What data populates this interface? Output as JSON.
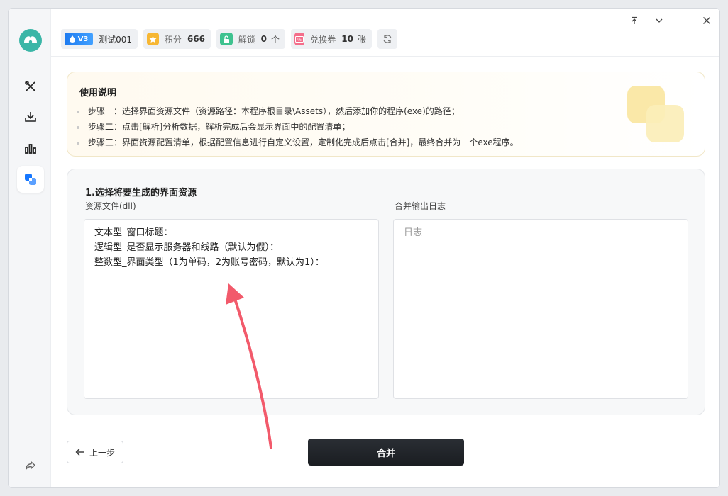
{
  "header": {
    "version_badge": "V3",
    "user_name": "测试001",
    "points_label": "积分",
    "points_value": "666",
    "unlock_label": "解锁",
    "unlock_value": "0",
    "unlock_unit": "个",
    "coupon_label": "兑换券",
    "coupon_value": "10",
    "coupon_unit": "张",
    "icons": [
      "drop-icon",
      "star-icon",
      "lock-icon",
      "coupon-icon",
      "refresh-icon"
    ]
  },
  "window_controls": [
    "pin-top-icon",
    "minimize-icon",
    "close-icon"
  ],
  "sidebar": {
    "items": [
      "tools-icon",
      "download-icon",
      "stats-icon",
      "merge-icon"
    ],
    "active": 3,
    "bottom": "share-icon"
  },
  "instructions": {
    "title": "使用说明",
    "steps": [
      "步骤一：选择界面资源文件（资源路径：本程序根目录\\Assets），然后添加你的程序(exe)的路径；",
      "步骤二：点击[解析]分析数据，解析完成后会显示界面中的配置清单；",
      "步骤三：界面资源配置清单，根据配置信息进行自定义设置，定制化完成后点击[合并]，最终合并为一个exe程序。"
    ]
  },
  "section": {
    "title": "1.选择将要生成的界面资源",
    "resource_label": "资源文件(dll)",
    "resource_lines": [
      "文本型_窗口标题：",
      "逻辑型_是否显示服务器和线路（默认为假）：",
      "整数型_界面类型（1为单码，2为账号密码，默认为1）："
    ],
    "log_label": "合并输出日志",
    "log_placeholder": "日志"
  },
  "footer": {
    "back_label": "上一步",
    "merge_label": "合并"
  },
  "colors": {
    "accent_teal": "#3bb6a7",
    "arrow": "#f25a6b",
    "merge_button": "#1f2227"
  }
}
